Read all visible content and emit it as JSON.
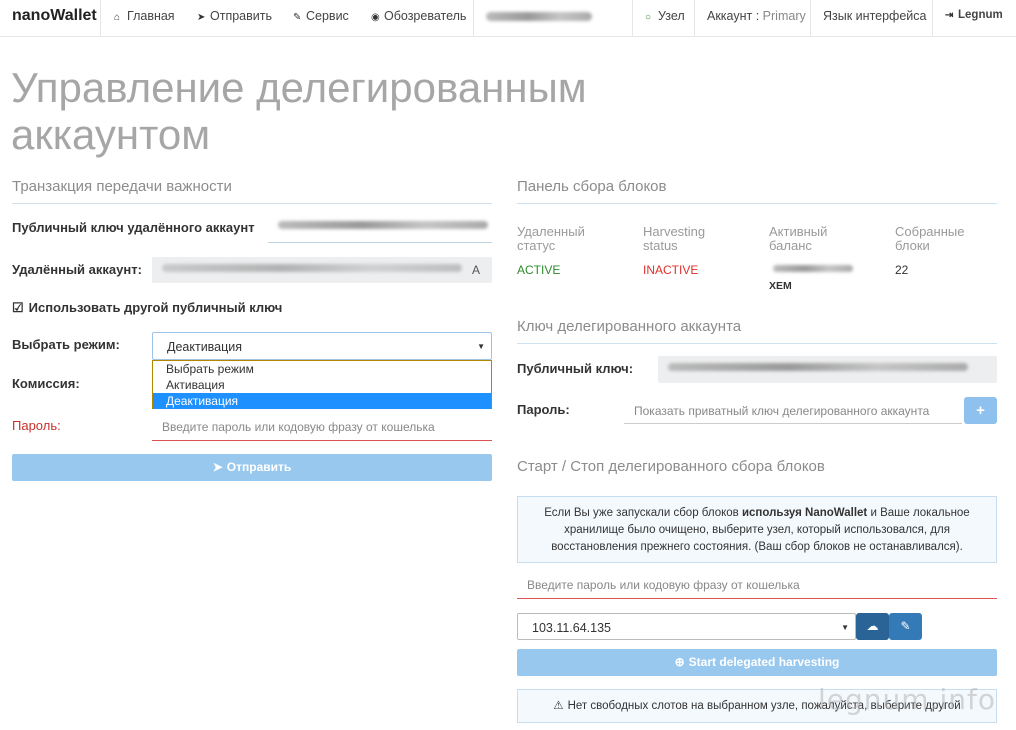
{
  "navbar": {
    "brand": "nanoWallet",
    "items": [
      {
        "label": "Главная",
        "icon": "home-icon"
      },
      {
        "label": "Отправить",
        "icon": "send-icon"
      },
      {
        "label": "Сервис",
        "icon": "wrench-icon"
      },
      {
        "label": "Обозреватель",
        "icon": "globe-icon"
      }
    ],
    "node": "Узел",
    "account": "Аккаунт : ",
    "account_name": "Primary",
    "language": "Язык интерфейса",
    "logout": "Legnum"
  },
  "page_title": "Управление делегированным аккаунтом",
  "transfer": {
    "title": "Транзакция передачи важности",
    "public_key_label": "Публичный ключ удалённого аккаунт",
    "remote_account_label": "Удалённый аккаунт:",
    "remote_account_suffix": "A",
    "use_other_key_label": "Использовать другой публичный ключ",
    "mode_label": "Выбрать режим:",
    "mode_selected": "Деактивация",
    "mode_options": [
      "Выбрать режим",
      "Активация",
      "Деактивация"
    ],
    "fee_label": "Комиссия:",
    "password_label": "Пароль:",
    "password_placeholder": "Введите пароль или кодовую фразу от кошелька",
    "send_button": "Отправить"
  },
  "harvest_panel": {
    "title": "Панель сбора блоков",
    "headers": [
      "Удаленный статус",
      "Harvesting status",
      "Активный баланс",
      "Собранные блоки"
    ],
    "remote_status": "ACTIVE",
    "harvesting_status": "INACTIVE",
    "balance_unit": "XEM",
    "harvested_blocks": "22",
    "colors": {
      "active": "#2e8b2e",
      "inactive": "#e0302a"
    }
  },
  "delegated_key": {
    "title": "Ключ делегированного аккаунта",
    "public_key_label": "Публичный ключ:",
    "password_label": "Пароль:",
    "password_placeholder": "Показать приватный ключ делегированного аккаунта",
    "show_button": "+"
  },
  "start_stop": {
    "title": "Старт / Стоп делегированного сбора блоков",
    "info_text_1": "Если Вы уже запускали сбор блоков ",
    "info_text_bold": "используя NanoWallet",
    "info_text_2": " и Ваше локальное хранилище было очищено, выберите узел, который использовался, для восстановления прежнего состояния. (Ваш сбор блоков не останавливался).",
    "password_placeholder": "Введите пароль или кодовую фразу от кошелька",
    "node_selected": "103.11.64.135",
    "start_button": "Start delegated harvesting",
    "warning": "Нет свободных слотов на выбранном узле, пожалуйста, выберите другой"
  },
  "watermark": "legnum.info"
}
